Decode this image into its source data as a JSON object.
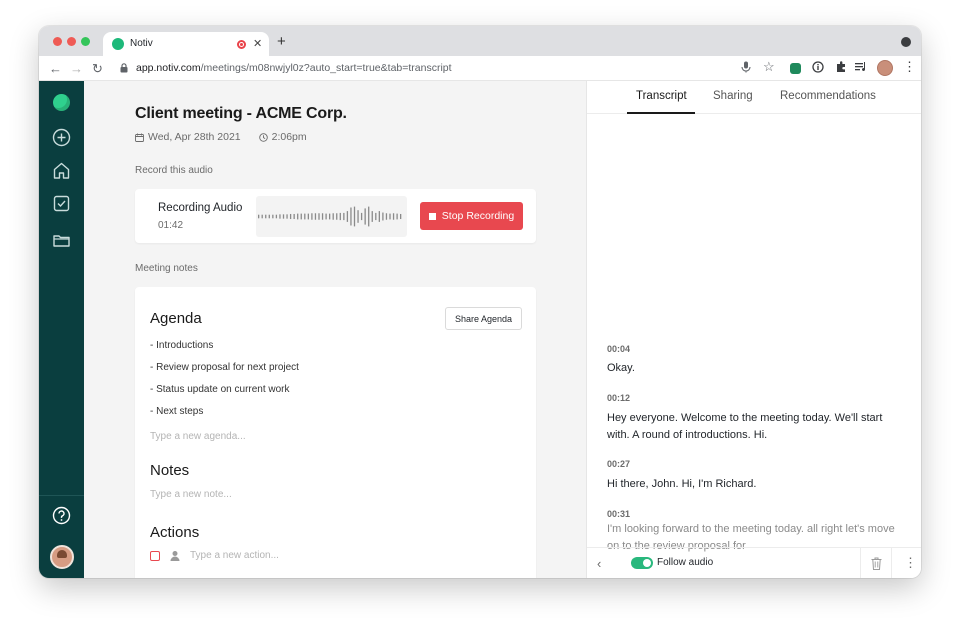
{
  "browser": {
    "tab_title": "Notiv",
    "url_host": "app.notiv.com",
    "url_rest": "/meetings/m08nwjyl0z?auto_start=true&tab=transcript"
  },
  "meeting": {
    "title": "Client meeting - ACME Corp.",
    "date": "Wed, Apr 28th 2021",
    "time": "2:06pm"
  },
  "recording": {
    "section_label": "Record this audio",
    "status_label": "Recording Audio",
    "elapsed": "01:42",
    "stop_label": "Stop Recording",
    "waveform_levels": [
      0.1,
      0.1,
      0.1,
      0.1,
      0.1,
      0.1,
      0.12,
      0.12,
      0.12,
      0.14,
      0.14,
      0.16,
      0.16,
      0.16,
      0.16,
      0.18,
      0.18,
      0.18,
      0.18,
      0.16,
      0.16,
      0.18,
      0.18,
      0.2,
      0.2,
      0.3,
      0.5,
      0.55,
      0.35,
      0.2,
      0.45,
      0.55,
      0.3,
      0.2,
      0.3,
      0.22,
      0.18,
      0.16,
      0.18,
      0.16,
      0.14
    ]
  },
  "notes": {
    "section_label": "Meeting notes",
    "agenda_heading": "Agenda",
    "share_label": "Share Agenda",
    "agenda_items": [
      "- Introductions",
      "- Review proposal for next project",
      "- Status update on current work",
      "- Next steps"
    ],
    "agenda_placeholder": "Type a new agenda...",
    "notes_heading": "Notes",
    "notes_placeholder": "Type a new note...",
    "actions_heading": "Actions",
    "action_placeholder": "Type a new action..."
  },
  "panel": {
    "tabs": [
      "Transcript",
      "Sharing",
      "Recommendations"
    ],
    "active_tab": "Transcript",
    "transcript": [
      {
        "time": "00:04",
        "text": "Okay."
      },
      {
        "time": "00:12",
        "text": "Hey everyone. Welcome to the meeting today. We'll start with. A round of introductions. Hi."
      },
      {
        "time": "00:27",
        "text": "Hi there, John. Hi, I'm Richard."
      },
      {
        "time": "00:31",
        "text": "I'm looking forward to the meeting today. all right let's move on to the review proposal for"
      }
    ],
    "follow_label": "Follow audio",
    "follow_enabled": true
  },
  "colors": {
    "sidebar": "#0a3e3f",
    "accent_green": "#29b87d",
    "record_red": "#e8484f"
  }
}
